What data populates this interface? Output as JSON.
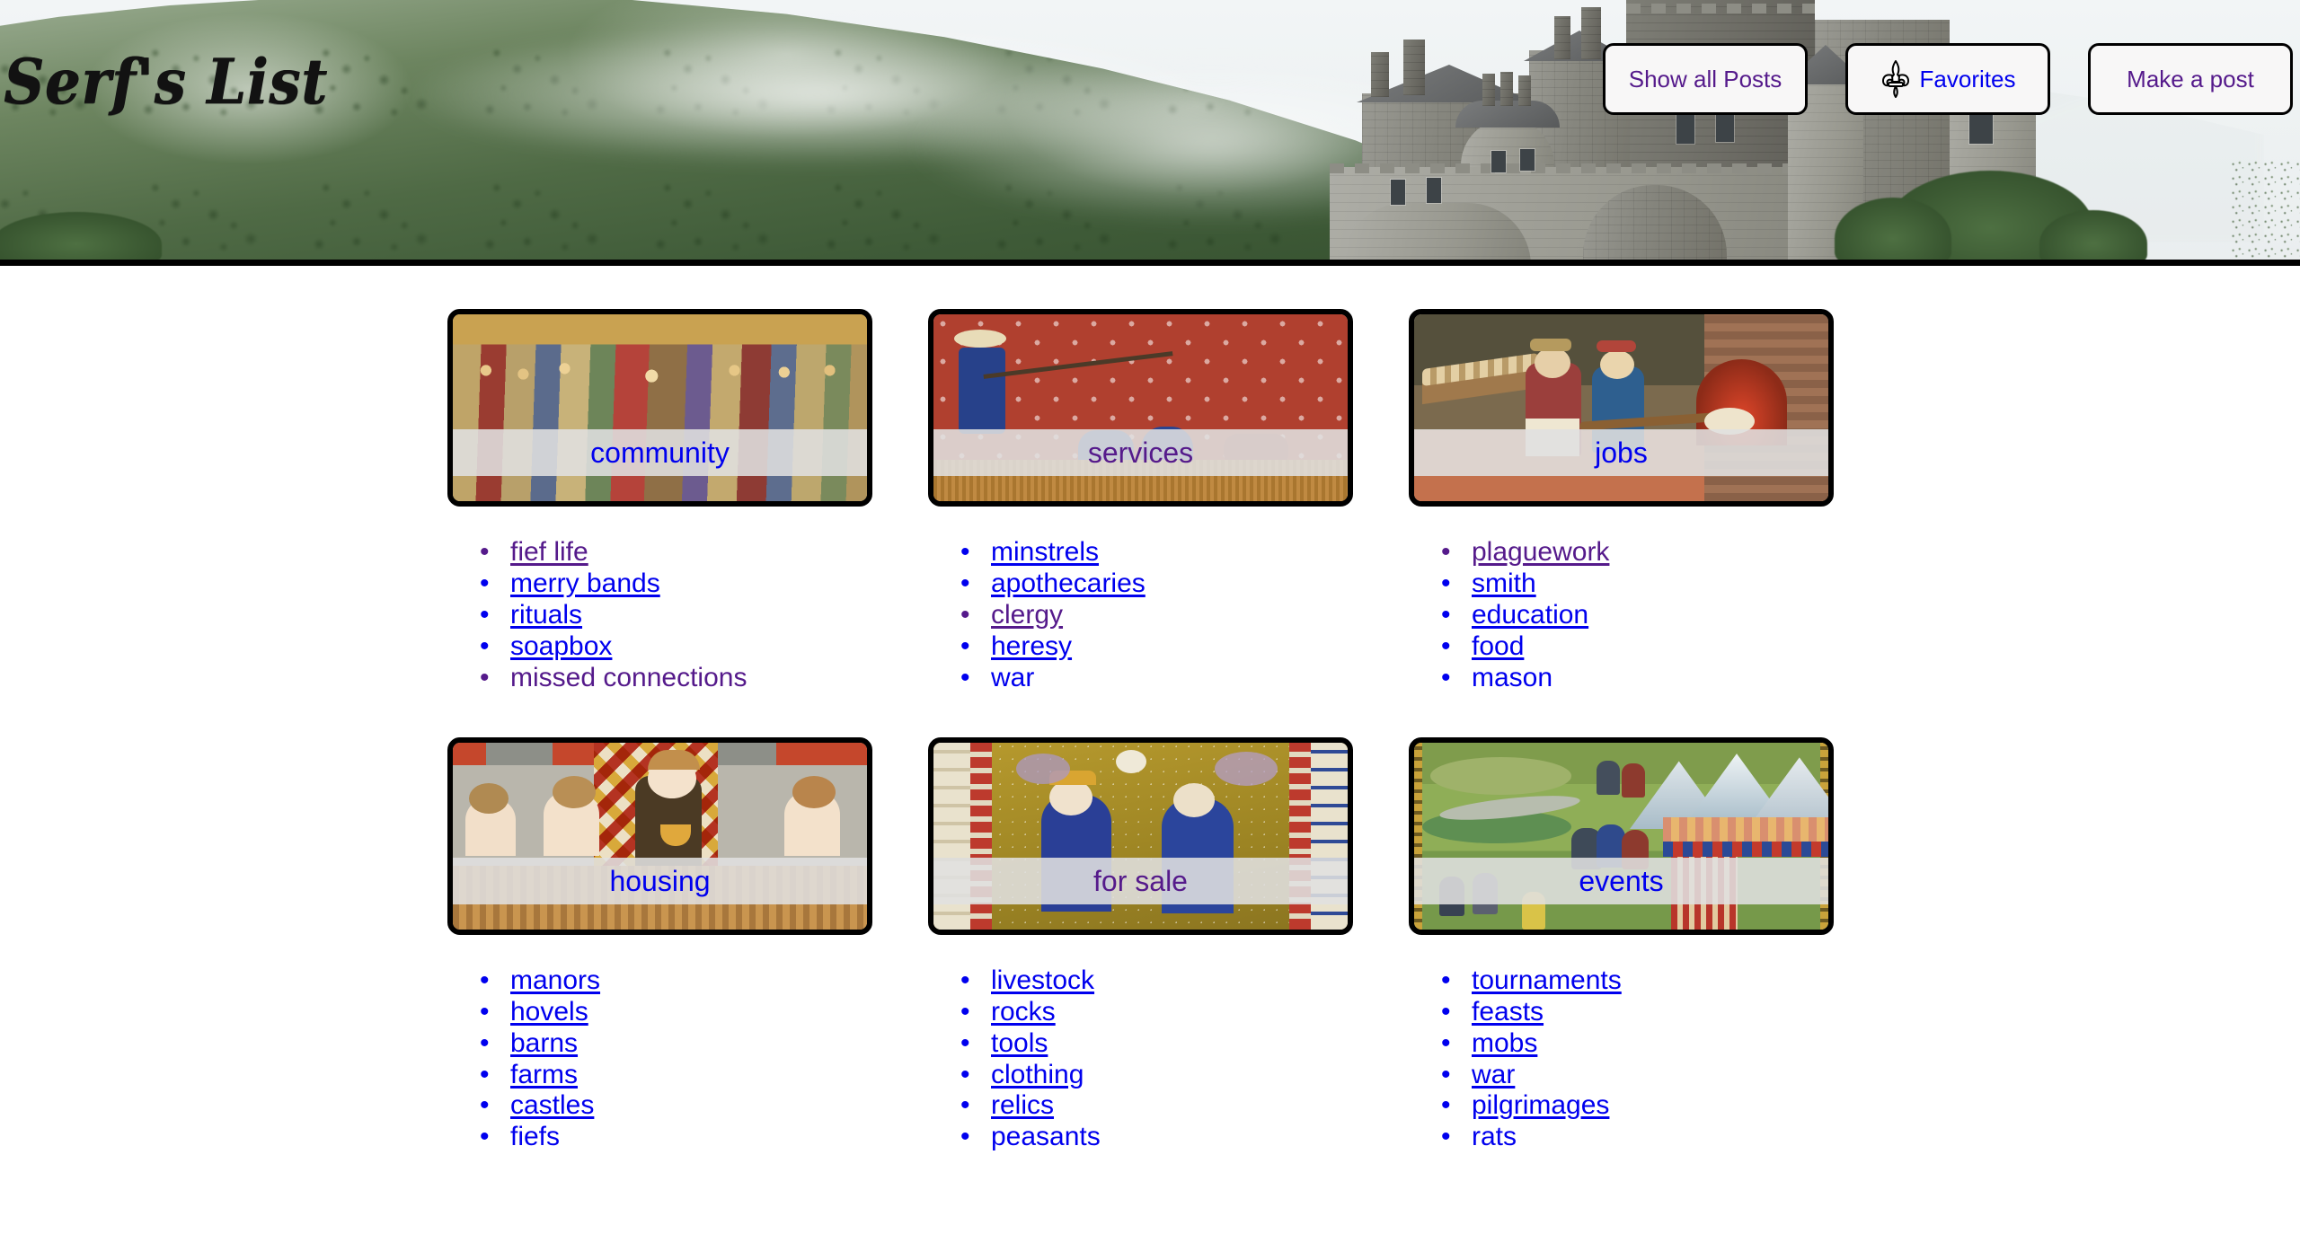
{
  "site": {
    "title": "Serf's List"
  },
  "header": {
    "buttons": [
      {
        "label": "Show all Posts",
        "state": "visited",
        "icon": null
      },
      {
        "label": "Favorites",
        "state": "unvisited",
        "icon": "fleur-de-lis-icon"
      },
      {
        "label": "Make a post",
        "state": "visited",
        "icon": null
      }
    ]
  },
  "colors": {
    "link_unvisited": "#0000ee",
    "link_visited": "#551a8b",
    "border": "#000000",
    "label_band": "#e0e0e0",
    "page_background": "#ffffff"
  },
  "categories": [
    {
      "id": "community",
      "label": "community",
      "label_state": "visited_no",
      "image_alt": "medieval fresco of a coronation surrounded by bishops and nobles",
      "links": [
        {
          "text": "fief life",
          "state": "visited"
        },
        {
          "text": "merry bands",
          "state": "unvisited"
        },
        {
          "text": "rituals",
          "state": "unvisited"
        },
        {
          "text": "soapbox",
          "state": "unvisited"
        },
        {
          "text": "missed connections",
          "state": "visited"
        }
      ]
    },
    {
      "id": "services",
      "label": "services",
      "label_state": "visited_yes",
      "image_alt": "medieval manuscript of a man with a staff driving figures before a red patterned wall",
      "links": [
        {
          "text": "minstrels",
          "state": "unvisited"
        },
        {
          "text": "apothecaries",
          "state": "unvisited"
        },
        {
          "text": "clergy",
          "state": "visited"
        },
        {
          "text": "heresy",
          "state": "unvisited"
        },
        {
          "text": "war",
          "state": "unvisited"
        }
      ]
    },
    {
      "id": "jobs",
      "label": "jobs",
      "label_state": "visited_no",
      "image_alt": "medieval bakers loading bread into a brick oven",
      "links": [
        {
          "text": "plaguework",
          "state": "visited"
        },
        {
          "text": "smith",
          "state": "unvisited"
        },
        {
          "text": "education",
          "state": "unvisited"
        },
        {
          "text": "food",
          "state": "unvisited"
        },
        {
          "text": "mason",
          "state": "unvisited"
        }
      ]
    },
    {
      "id": "housing",
      "label": "housing",
      "label_state": "visited_no",
      "image_alt": "medieval illumination of a bathhouse with bathers in wooden tubs",
      "links": [
        {
          "text": "manors",
          "state": "unvisited"
        },
        {
          "text": "hovels",
          "state": "unvisited"
        },
        {
          "text": "barns",
          "state": "unvisited"
        },
        {
          "text": "farms",
          "state": "unvisited"
        },
        {
          "text": "castles",
          "state": "unvisited"
        },
        {
          "text": "fiefs",
          "state": "unvisited"
        }
      ]
    },
    {
      "id": "for-sale",
      "label": "for sale",
      "label_state": "visited_yes",
      "image_alt": "illuminated manuscript of a crowned queen and a kneeling man on gold leaf ground",
      "links": [
        {
          "text": "livestock",
          "state": "unvisited"
        },
        {
          "text": "rocks",
          "state": "unvisited"
        },
        {
          "text": "tools",
          "state": "unvisited"
        },
        {
          "text": "clothing",
          "state": "unvisited"
        },
        {
          "text": "relics",
          "state": "unvisited"
        },
        {
          "text": "peasants",
          "state": "unvisited"
        }
      ]
    },
    {
      "id": "events",
      "label": "events",
      "label_state": "visited_no",
      "image_alt": "medieval tournament encampment with knights and striped pavilion tents",
      "links": [
        {
          "text": "tournaments",
          "state": "unvisited"
        },
        {
          "text": "feasts",
          "state": "unvisited"
        },
        {
          "text": "mobs",
          "state": "unvisited"
        },
        {
          "text": "war",
          "state": "unvisited"
        },
        {
          "text": "pilgrimages",
          "state": "unvisited"
        },
        {
          "text": "rats",
          "state": "unvisited"
        }
      ]
    }
  ]
}
